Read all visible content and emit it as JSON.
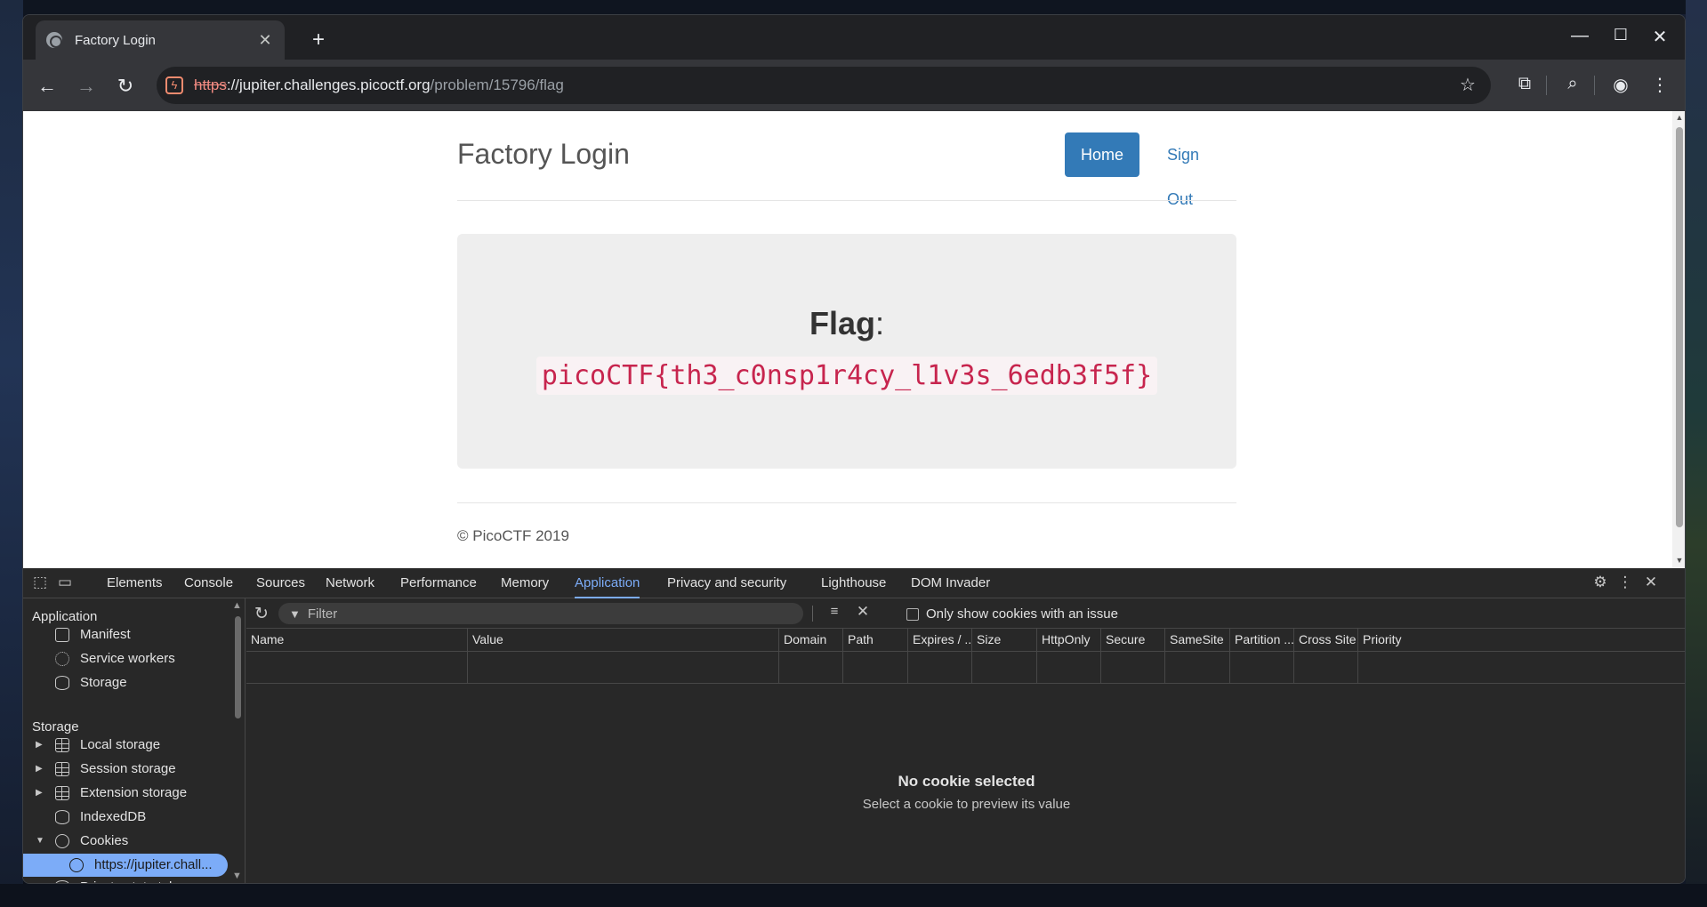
{
  "browser": {
    "tab_title": "Factory Login",
    "tab_close": "✕",
    "new_tab": "+",
    "url_scheme": "https",
    "url_host": "://jupiter.challenges.picoctf.org",
    "url_path": "/problem/15796/flag"
  },
  "page": {
    "site_title": "Factory Login",
    "nav_home": "Home",
    "nav_signout": "Sign Out",
    "flag_label": "Flag",
    "flag_colon": ":",
    "flag_value": "picoCTF{th3_c0nsp1r4cy_l1v3s_6edb3f5f}",
    "footer": "© PicoCTF 2019"
  },
  "devtools": {
    "tabs": [
      "Elements",
      "Console",
      "Sources",
      "Network",
      "Performance",
      "Memory",
      "Application",
      "Privacy and security",
      "Lighthouse",
      "DOM Invader"
    ],
    "active_tab": "Application",
    "sidebar": {
      "application_header": "Application",
      "application_items": [
        "Manifest",
        "Service workers",
        "Storage"
      ],
      "storage_header": "Storage",
      "storage_items": [
        "Local storage",
        "Session storage",
        "Extension storage",
        "IndexedDB",
        "Cookies"
      ],
      "cookie_origin": "https://jupiter.chall...",
      "cut_off_item": "Private state tokens"
    },
    "cookies": {
      "filter_placeholder": "Filter",
      "only_issue_label": "Only show cookies with an issue",
      "columns": [
        "Name",
        "Value",
        "Domain",
        "Path",
        "Expires / ...",
        "Size",
        "HttpOnly",
        "Secure",
        "SameSite",
        "Partition ...",
        "Cross Site",
        "Priority"
      ],
      "empty_title": "No cookie selected",
      "empty_subtitle": "Select a cookie to preview its value"
    }
  },
  "colors": {
    "accent": "#7cacf8",
    "home_button": "#337ab7",
    "flag_text": "#c7254e"
  }
}
